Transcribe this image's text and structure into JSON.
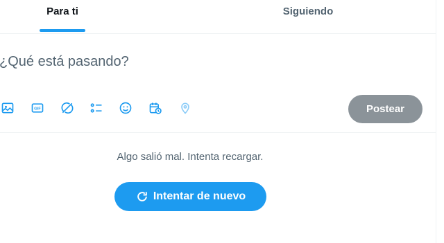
{
  "tabs": [
    {
      "label": "Para ti",
      "active": true
    },
    {
      "label": "Siguiendo",
      "active": false
    }
  ],
  "composer": {
    "placeholder": "¿Qué está pasando?",
    "post_label": "Postear",
    "icons": [
      "image-icon",
      "gif-icon",
      "grok-icon",
      "poll-icon",
      "emoji-icon",
      "schedule-icon",
      "location-icon"
    ]
  },
  "error": {
    "message": "Algo salió mal. Intenta recargar.",
    "retry_label": "Intentar de nuevo"
  },
  "colors": {
    "accent": "#1d9bf0",
    "post_disabled": "#8b9399",
    "muted_text": "#536471"
  }
}
